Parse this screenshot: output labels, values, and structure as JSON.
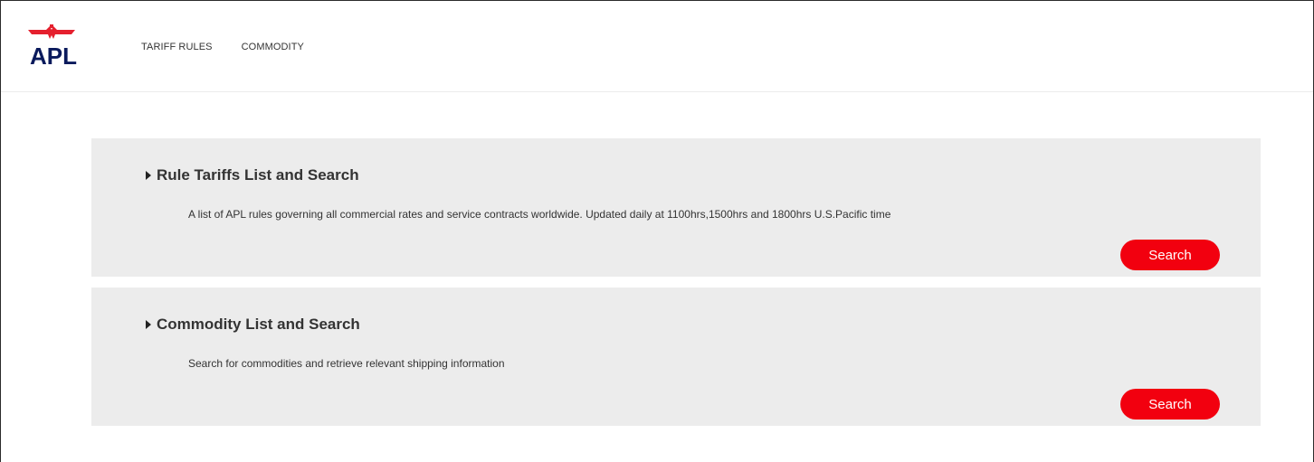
{
  "brand": {
    "logo_text": "APL",
    "colors": {
      "red": "#f2000f",
      "navy": "#0a1a5c",
      "card_bg": "#ececec"
    },
    "icon": "eagle-logo-icon"
  },
  "nav": {
    "items": [
      {
        "label": "TARIFF RULES"
      },
      {
        "label": "COMMODITY"
      }
    ]
  },
  "cards": [
    {
      "title": "Rule Tariffs List and Search",
      "description": "A list of APL rules governing all commercial rates and service contracts worldwide. Updated daily at 1100hrs,1500hrs and 1800hrs U.S.Pacific time",
      "button_label": "Search",
      "icon": "caret-right-icon"
    },
    {
      "title": "Commodity List and Search",
      "description": "Search for commodities and retrieve relevant shipping information",
      "button_label": "Search",
      "icon": "caret-right-icon"
    }
  ]
}
